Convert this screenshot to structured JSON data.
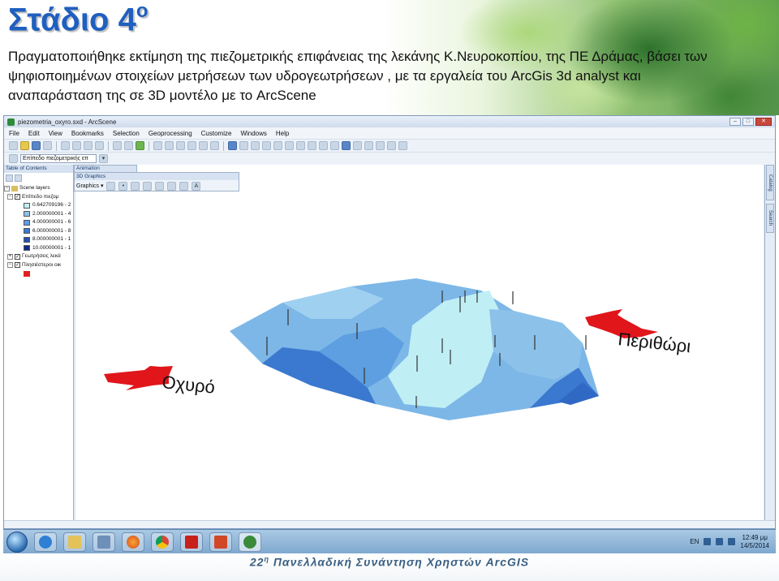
{
  "slide": {
    "title_main": "Στάδιο 4",
    "title_sup": "ο",
    "body_text": "Πραγματοποιήθηκε εκτίμηση της πιεζομετρικής επιφάνειας της λεκάνης Κ.Νευροκοπίου, της ΠΕ Δράμας, βάσει των ψηφιοποιημένων στοιχείων μετρήσεων των υδρογεωτρήσεων , με τα εργαλεία του ArcGis 3d analyst και αναπαράσταση της σε 3D μοντέλο με το ArcScene"
  },
  "window": {
    "title": "piezometria_oxyro.sxd - ArcScene",
    "controls": [
      "–",
      "□",
      "✕"
    ]
  },
  "menu": [
    "File",
    "Edit",
    "View",
    "Bookmarks",
    "Selection",
    "Geoprocessing",
    "Customize",
    "Windows",
    "Help"
  ],
  "layer_dropdown": "Επίπεδο πιεζομετρικής επ",
  "toc": {
    "header": "Table of Contents",
    "scene_layers": "Scene layers",
    "layer1": "Επίπεδο πιεζομ",
    "legend": [
      {
        "label": "0.642709196 - 2",
        "color": "#bfeff4"
      },
      {
        "label": "2.000000001 - 4",
        "color": "#8cc2ea"
      },
      {
        "label": "4.000000001 - 6",
        "color": "#5d9fe0"
      },
      {
        "label": "6.000000001 - 8",
        "color": "#3b78cf"
      },
      {
        "label": "8.000000001 - 1",
        "color": "#2452b3"
      },
      {
        "label": "10.00000001 - 1",
        "color": "#0f2a8c"
      }
    ],
    "layer2": "Γεωτρήσεις λεκά",
    "layer3": "Πλησιέστεροι οικ",
    "layer3_color": "#e02020"
  },
  "floating": {
    "animation": "Animation",
    "graphics_3d": "3D Graphics",
    "graphics_menu": "Graphics ▾"
  },
  "dock_tabs": [
    "Catalog",
    "Search"
  ],
  "scene_labels": {
    "left": "Οχυρό",
    "right": "Περιθώρι"
  },
  "colors": {
    "arrow_red": "#e0161b",
    "surface_light": "#bfeff4",
    "surface_mid": "#8cc2ea",
    "surface_dark": "#3b78cf"
  },
  "taskbar": {
    "language": "EN",
    "time": "12:49 μμ",
    "date": "14/5/2014"
  },
  "footer": {
    "number": "22",
    "sup": "η",
    "text": "Πανελλαδική Συνάντηση Χρηστών ArcGIS"
  }
}
